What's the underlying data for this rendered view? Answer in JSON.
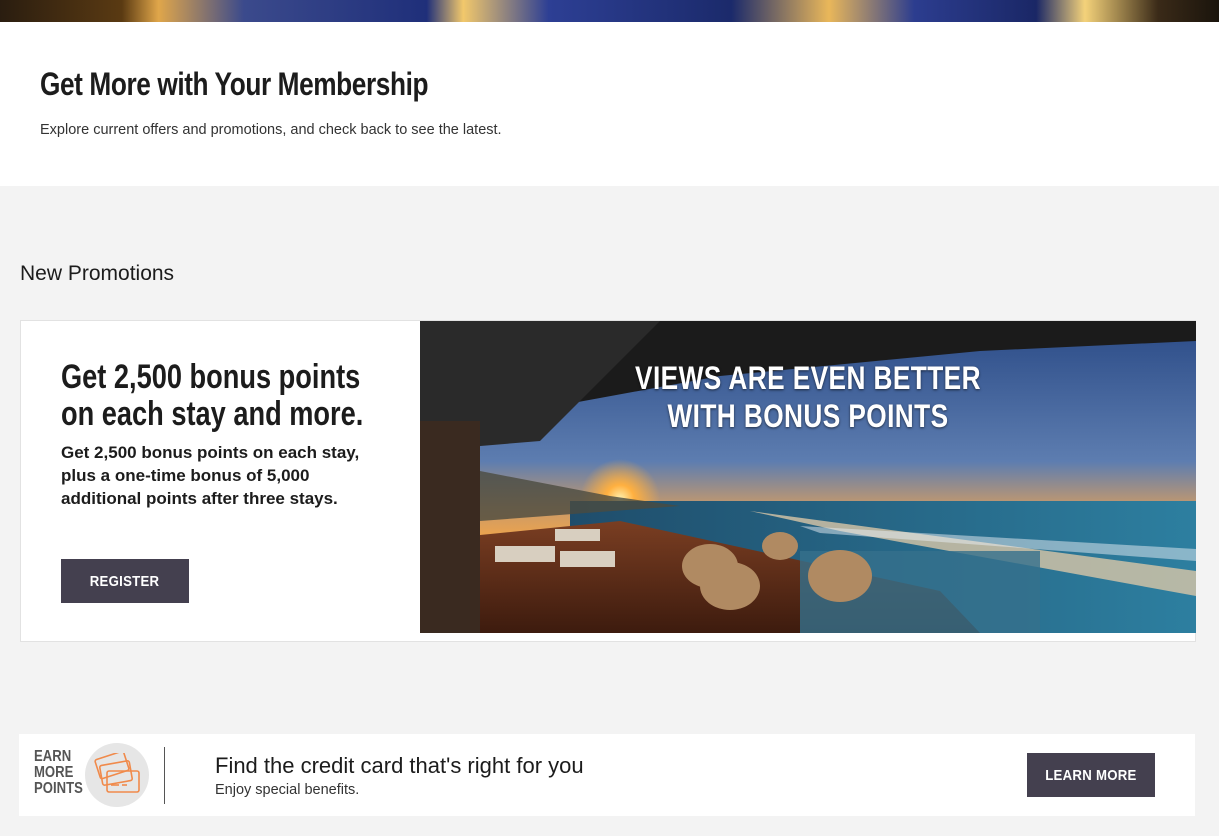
{
  "intro": {
    "title": "Get More with Your Membership",
    "subtitle": "Explore current offers and promotions, and check back to see the latest."
  },
  "promotions": {
    "section_title": "New Promotions",
    "card": {
      "heading": "Get 2,500 bonus points on each stay and more.",
      "description": "Get 2,500 bonus points on each stay, plus a one-time bonus of 5,000 additional points after three stays.",
      "button_label": "REGISTER",
      "image_overlay_line1": "VIEWS ARE EVEN BETTER",
      "image_overlay_line2": "WITH BONUS POINTS"
    }
  },
  "credit_card": {
    "badge_line1": "EARN",
    "badge_line2": "MORE",
    "badge_line3": "POINTS",
    "icon": "credit-card-icon",
    "title": "Find the credit card that's right for you",
    "subtitle": "Enjoy special benefits.",
    "button_label": "LEARN MORE",
    "icon_color": "#f08a4b"
  },
  "colors": {
    "button": "#44404f",
    "background": "#f3f3f3"
  }
}
